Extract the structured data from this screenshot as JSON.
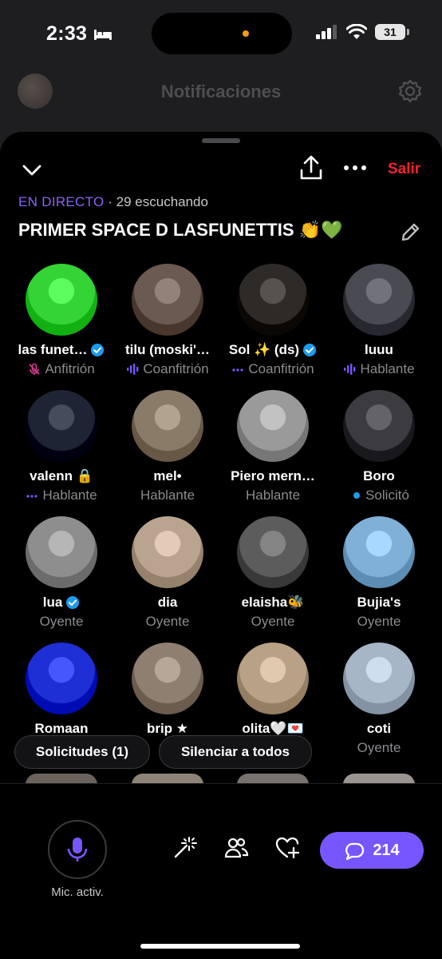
{
  "status_bar": {
    "time": "2:33",
    "battery": "31"
  },
  "background_header": {
    "title": "Notificaciones"
  },
  "space": {
    "close_label": "Salir",
    "live_label": "EN DIRECTO",
    "listeners": " · 29 escuchando",
    "title": "PRIMER SPACE D LASFUNETTIS 👏💚"
  },
  "participants": [
    {
      "name": "las funet…",
      "role": "Anfitrión",
      "verified": true,
      "role_icon": "muted-mic-icon",
      "avatar_color": "#35d435"
    },
    {
      "name": "tilu (moski'…",
      "role": "Coanfitrión",
      "verified": false,
      "role_icon": "speaking-bars-icon",
      "avatar_color": "#6a5a4f"
    },
    {
      "name": "Sol ✨ (ds)",
      "role": "Coanfitrión",
      "verified": true,
      "role_icon": "dots-icon",
      "avatar_color": "#2e2a28"
    },
    {
      "name": "luuu",
      "role": "Hablante",
      "verified": false,
      "role_icon": "speaking-bars-icon",
      "avatar_color": "#4a4a52"
    },
    {
      "name": "valenn 🔒",
      "role": "Hablante",
      "verified": false,
      "role_icon": "dots-icon",
      "avatar_color": "#1e2433"
    },
    {
      "name": "mel•",
      "role": "Hablante",
      "verified": false,
      "role_icon": "",
      "avatar_color": "#8a7a68"
    },
    {
      "name": "Piero mern…",
      "role": "Hablante",
      "verified": false,
      "role_icon": "",
      "avatar_color": "#9a9a9a"
    },
    {
      "name": "Boro",
      "role": "Solicitó",
      "verified": false,
      "role_icon": "blue-dot-icon",
      "avatar_color": "#3b3b40"
    },
    {
      "name": "lua",
      "role": "Oyente",
      "verified": true,
      "role_icon": "",
      "avatar_color": "#8e8e8e"
    },
    {
      "name": "dia",
      "role": "Oyente",
      "verified": false,
      "role_icon": "",
      "avatar_color": "#b9a48f"
    },
    {
      "name": "elaisha🐝",
      "role": "Oyente",
      "verified": false,
      "role_icon": "",
      "avatar_color": "#5c5c5c"
    },
    {
      "name": "Bujia's",
      "role": "Oyente",
      "verified": false,
      "role_icon": "",
      "avatar_color": "#7fb0d8"
    },
    {
      "name": "Romaan",
      "role": "",
      "verified": false,
      "role_icon": "",
      "avatar_color": "#1f2fd6"
    },
    {
      "name": "brip ★",
      "role": "Oy",
      "verified": false,
      "role_icon": "",
      "avatar_color": "#8f7f70"
    },
    {
      "name": "olita🤍💌",
      "role": "",
      "verified": false,
      "role_icon": "",
      "avatar_color": "#b8a184"
    },
    {
      "name": "coti",
      "role": "Oyente",
      "verified": false,
      "role_icon": "",
      "avatar_color": "#a7b6c6"
    }
  ],
  "pills": {
    "requests": "Solicitudes (1)",
    "mute_all": "Silenciar a todos"
  },
  "bottom_bar": {
    "mic_label": "Mic. activ.",
    "comments_count": "214"
  },
  "colors": {
    "accent": "#7856ff",
    "live": "#8a63f3",
    "danger": "#f4212e",
    "verified": "#1d9bf0"
  }
}
